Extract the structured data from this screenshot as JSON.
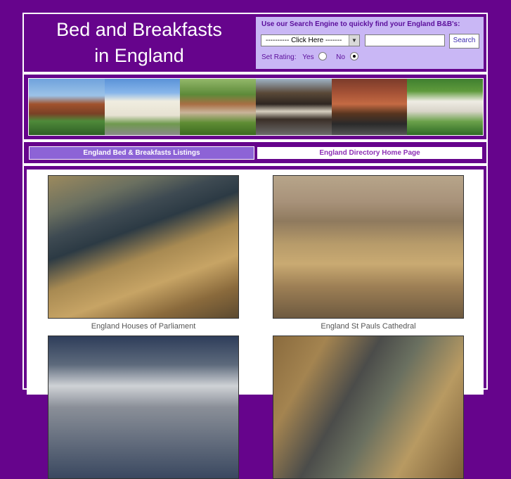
{
  "header": {
    "title_line1": "Bed and Breakfasts",
    "title_line2": "in England"
  },
  "search": {
    "heading": "Use our Search Engine to quickly find your England B&B's:",
    "category_select_value": "---------- Click Here -------",
    "text_placeholder": "",
    "button_label": "Search",
    "rating_label": "Set Rating:",
    "rating_yes_label": "Yes",
    "rating_no_label": "No",
    "rating_selected": "No"
  },
  "nav": {
    "tabs": [
      {
        "label": "England Bed & Breakfasts Listings",
        "active": true
      },
      {
        "label": "England Directory Home Page",
        "active": false
      }
    ]
  },
  "gallery": [
    {
      "caption": "England Houses of Parliament"
    },
    {
      "caption": "England St Pauls Cathedral"
    },
    {
      "caption": ""
    },
    {
      "caption": ""
    }
  ],
  "colors": {
    "page_background": "#66048c",
    "search_panel": "#c9b7f5",
    "active_tab": "#8d63d6",
    "link_text": "#8d2fb5"
  }
}
